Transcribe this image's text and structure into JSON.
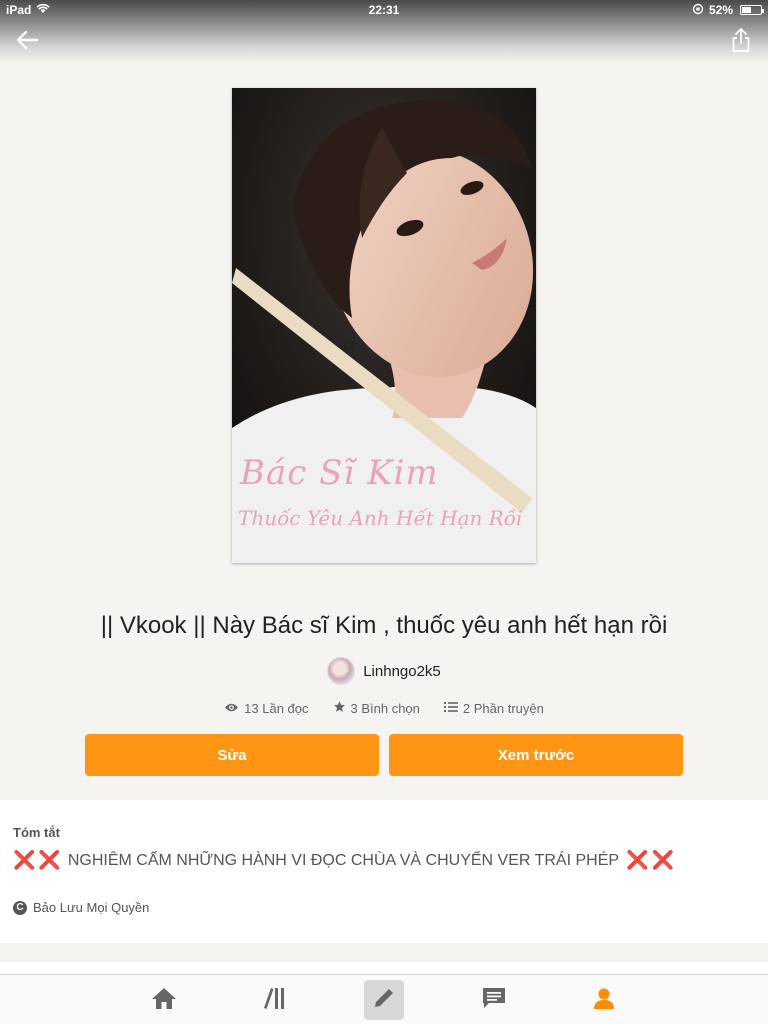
{
  "status_bar": {
    "device": "iPad",
    "time": "22:31",
    "battery_percent": "52%",
    "battery_level": 0.52
  },
  "nav": {
    "back_icon": "arrow-left-icon",
    "share_icon": "share-icon"
  },
  "cover": {
    "title": "Bác Sĩ Kim",
    "subtitle": "Thuốc Yêu Anh Hết Hạn Rồi"
  },
  "story": {
    "title": "|| Vkook || Này Bác sĩ Kim , thuốc yêu anh hết hạn rồi",
    "author": "Linhngo2k5"
  },
  "stats": {
    "reads": "13 Lần đọc",
    "votes": "3 Bình chọn",
    "parts": "2 Phần truyện"
  },
  "actions": {
    "edit_label": "Sửa",
    "preview_label": "Xem trước"
  },
  "summary": {
    "label": "Tóm tắt",
    "text": "NGHIÊM CẤM NHỮNG HÀNH VI ĐỌC CHÙA VÀ CHUYỂN VER TRÁI PHÉP",
    "mark": "❌",
    "copyright": "Bảo Lưu Mọi Quyền"
  },
  "tabbar": {
    "items": [
      "home-icon",
      "library-icon",
      "write-icon",
      "messages-icon",
      "profile-icon"
    ],
    "active": "write-icon",
    "accent": "#ff8c00"
  },
  "colors": {
    "accent": "#ff9613",
    "background": "#f5f4f0"
  }
}
